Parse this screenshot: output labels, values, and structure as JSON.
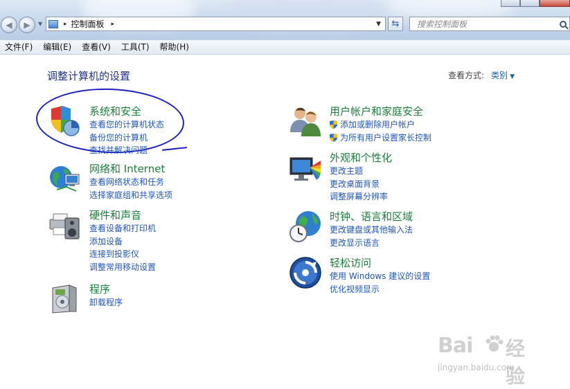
{
  "window": {
    "close_glyph": "x"
  },
  "nav": {
    "back_glyph": "◀",
    "forward_glyph": "▶"
  },
  "address": {
    "location": "控制面板",
    "separator": "▸"
  },
  "search": {
    "placeholder": "搜索控制面板"
  },
  "menu": [
    "文件(F)",
    "编辑(E)",
    "查看(V)",
    "工具(T)",
    "帮助(H)"
  ],
  "main": {
    "title": "调整计算机的设置",
    "view_label": "查看方式:",
    "view_value": "类别"
  },
  "categories": [
    {
      "title": "系统和安全",
      "icon": "shield-chart-icon",
      "links": [
        "查看您的计算机状态",
        "备份您的计算机",
        "查找并解决问题"
      ]
    },
    {
      "title": "网络和 Internet",
      "icon": "globe-network-icon",
      "links": [
        "查看网络状态和任务",
        "选择家庭组和共享选项"
      ]
    },
    {
      "title": "硬件和声音",
      "icon": "printer-speaker-icon",
      "links": [
        "查看设备和打印机",
        "添加设备",
        "连接到投影仪",
        "调整常用移动设置"
      ]
    },
    {
      "title": "程序",
      "icon": "program-box-icon",
      "links": [
        "卸载程序"
      ]
    },
    {
      "title": "用户帐户和家庭安全",
      "icon": "users-icon",
      "links": [
        "添加或删除用户帐户",
        "为所有用户设置家长控制"
      ]
    },
    {
      "title": "外观和个性化",
      "icon": "monitor-palette-icon",
      "links": [
        "更改主题",
        "更改桌面背景",
        "调整屏幕分辨率"
      ]
    },
    {
      "title": "时钟、语言和区域",
      "icon": "clock-globe-icon",
      "links": [
        "更改键盘或其他输入法",
        "更改显示语言"
      ]
    },
    {
      "title": "轻松访问",
      "icon": "ease-of-access-icon",
      "links": [
        "使用 Windows 建议的设置",
        "优化视频显示"
      ]
    }
  ],
  "watermark": {
    "logo": "Bai",
    "logo2": "经验",
    "url": "jingyan.baidu.com"
  },
  "colors": {
    "category_title": "#18803a",
    "link": "#1f56b8",
    "heading": "#1e3287",
    "annotation_circle": "#1d1fbf"
  }
}
